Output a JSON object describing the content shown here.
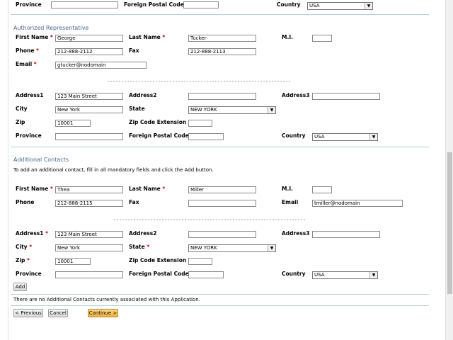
{
  "top_row": {
    "province_label": "Province",
    "foreign_postal_label": "Foreign Postal Code",
    "country_label": "Country",
    "country_value": "USA"
  },
  "auth_rep": {
    "section_title": "Authorized Representative",
    "first_name_label": "First Name",
    "first_name": "George",
    "last_name_label": "Last Name",
    "last_name": "Tucker",
    "mi_label": "M.I.",
    "phone_label": "Phone",
    "phone": "212-888-2112",
    "fax_label": "Fax",
    "fax": "212-888-2113",
    "email_label": "Email",
    "email": "gtucker@nodomain",
    "address1_label": "Address1",
    "address1": "123 Main Street",
    "address2_label": "Address2",
    "address3_label": "Address3",
    "city_label": "City",
    "city": "New York",
    "state_label": "State",
    "state": "NEW YORK",
    "zip_label": "Zip",
    "zip": "10001",
    "zip_ext_label": "Zip Code Extension",
    "province_label": "Province",
    "foreign_postal_label": "Foreign Postal Code",
    "country_label": "Country",
    "country": "USA"
  },
  "additional": {
    "section_title": "Additional Contacts",
    "instructions": "To add an additional contact, fill in all mandatory fields and click the Add button.",
    "first_name_label": "First Name",
    "first_name": "Thea",
    "last_name_label": "Last Name",
    "last_name": "Miller",
    "mi_label": "M.I.",
    "phone_label": "Phone",
    "phone": "212-888-2115",
    "fax_label": "Fax",
    "email_label": "Email",
    "email": "tmiller@nodomain",
    "address1_label": "Address1",
    "address1": "123 Main Street",
    "address2_label": "Address2",
    "address3_label": "Address3",
    "city_label": "City",
    "city": "New York",
    "state_label": "State",
    "state": "NEW YORK",
    "zip_label": "Zip",
    "zip": "10001",
    "zip_ext_label": "Zip Code Extension",
    "province_label": "Province",
    "foreign_postal_label": "Foreign Postal Code",
    "country_label": "Country",
    "country": "USA",
    "add_button": "Add",
    "no_contacts_text": "There are no Additional Contacts currently associated with this Application."
  },
  "nav": {
    "previous": "< Previous",
    "cancel": "Cancel",
    "continue": "Continue >"
  },
  "required_marker": "*",
  "select_arrow": "▼",
  "colors": {
    "section_title": "#4a6a8a",
    "divider": "#b9cfe0",
    "required": "#cc0000",
    "continue_button": "#f0b040"
  }
}
